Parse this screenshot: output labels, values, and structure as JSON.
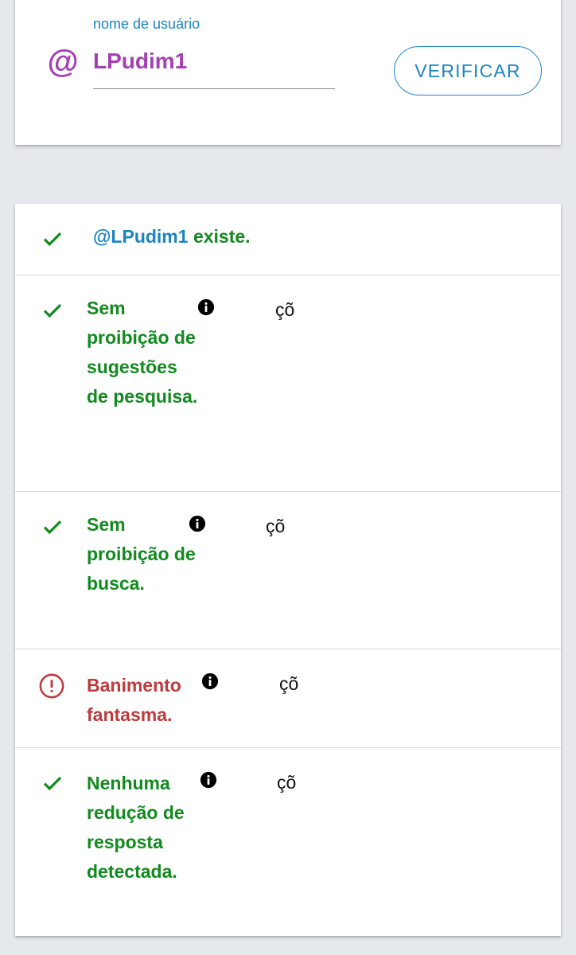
{
  "form": {
    "label": "nome de usuário",
    "at_symbol": "@",
    "username_value": "LPudim1",
    "verify_label": "VERIFICAR"
  },
  "results": {
    "exists": {
      "handle": "@LPudim1",
      "suffix": " existe."
    },
    "checks": [
      {
        "text": "Sem proibição de sugestões de pesquisa.",
        "status": "ok",
        "glyph": "çõ"
      },
      {
        "text": "Sem proibição de busca.",
        "status": "ok",
        "glyph": "çõ"
      },
      {
        "text": "Banimento fantasma.",
        "status": "warning",
        "glyph": "çõ"
      },
      {
        "text": "Nenhuma redução de resposta detectada.",
        "status": "ok",
        "glyph": "çõ"
      }
    ]
  },
  "icons": {
    "status_ok": "check-icon",
    "status_warning": "alert-circle-icon",
    "info": "info-icon",
    "username_prefix": "at-icon"
  },
  "colors": {
    "accent_blue": "#1a84c1",
    "username_purple": "#a43fb4",
    "ok_green": "#118a1e",
    "warning_red": "#c0393b",
    "background": "#e5e9ed"
  }
}
